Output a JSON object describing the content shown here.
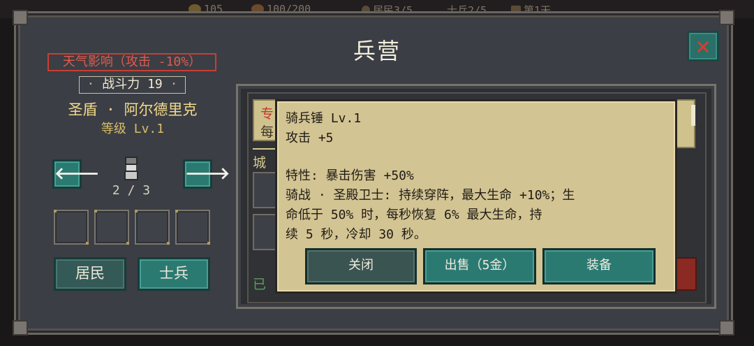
{
  "hud": {
    "gold": "105",
    "food": "100/200",
    "residents": "居民3/5",
    "soldiers": "士兵2/5",
    "day": "第1天"
  },
  "dialog": {
    "title": "兵营"
  },
  "hero": {
    "weather_effect": "天气影响（攻击 -10%）",
    "power_dot_left": "·",
    "power_label": "战斗力 19",
    "power_dot_right": "·",
    "name": "圣盾 · 阿尔德里克",
    "level": "等级 Lv.1",
    "prev_arrow": "🡐",
    "next_arrow": "🡒",
    "count": "2 / 3",
    "tabs": {
      "resident": "居民",
      "soldier": "士兵"
    }
  },
  "background_panel": {
    "card_text_1": "专",
    "card_text_2": "每",
    "city_label": "城",
    "done_label": "已"
  },
  "tooltip": {
    "item_name": "骑兵锤 Lv.1",
    "attack": "攻击 +5",
    "trait": "特性: 暴击伤害 +50%",
    "skill_line1": "骑战 · 圣殿卫士: 持续穿阵，最大生命 +10%；生",
    "skill_line2": "命低于 50% 时，每秒恢复 6% 最大生命，持",
    "skill_line3": "续 5 秒，冷却 30 秒。",
    "buttons": {
      "close": "关闭",
      "sell": "出售（5金）",
      "equip": "装备"
    }
  },
  "colors": {
    "teal_button": "#2b7a72",
    "parchment": "#d3c493",
    "weather_red": "#e25b4d",
    "hero_gold": "#f2d98c",
    "close_x": "#e03a2a"
  },
  "icons": {
    "close": "x-icon",
    "prev": "arrow-left-icon",
    "next": "arrow-right-icon",
    "avatar": "knight-avatar-icon"
  }
}
